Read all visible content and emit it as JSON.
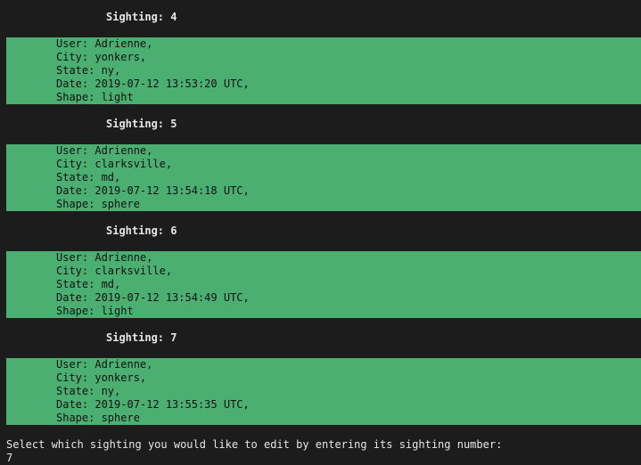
{
  "sightings": [
    {
      "heading": "Sighting: 4",
      "user": "User: Adrienne,",
      "city": "City: yonkers,",
      "state": "State: ny,",
      "date": "Date: 2019-07-12 13:53:20 UTC,",
      "shape": "Shape: light"
    },
    {
      "heading": "Sighting: 5",
      "user": "User: Adrienne,",
      "city": "City: clarksville,",
      "state": "State: md,",
      "date": "Date: 2019-07-12 13:54:18 UTC,",
      "shape": "Shape: sphere"
    },
    {
      "heading": "Sighting: 6",
      "user": "User: Adrienne,",
      "city": "City: clarksville,",
      "state": "State: md,",
      "date": "Date: 2019-07-12 13:54:49 UTC,",
      "shape": "Shape: light"
    },
    {
      "heading": "Sighting: 7",
      "user": "User: Adrienne,",
      "city": "City: yonkers,",
      "state": "State: ny,",
      "date": "Date: 2019-07-12 13:55:35 UTC,",
      "shape": "Shape: sphere"
    }
  ],
  "prompt": {
    "question": "Select which sighting you would like to edit by entering its sighting number:",
    "answer": "7"
  },
  "colors": {
    "background": "#1c1c1c",
    "record_highlight": "#4caf72"
  }
}
